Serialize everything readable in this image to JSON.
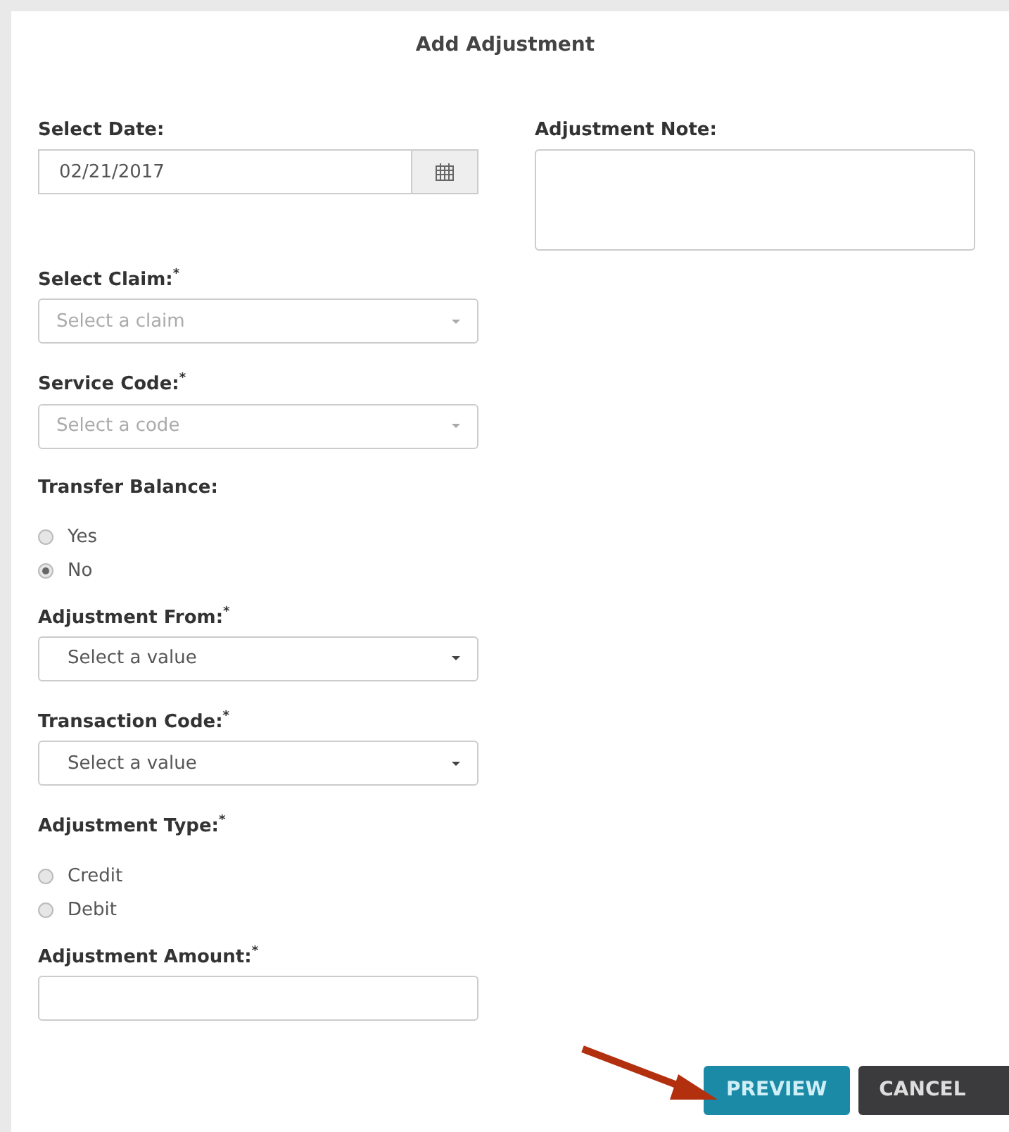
{
  "dialog": {
    "title": "Add Adjustment"
  },
  "date_field": {
    "label": "Select Date:",
    "value": "02/21/2017"
  },
  "note_field": {
    "label": "Adjustment Note:"
  },
  "fields": [
    {
      "kind": "combo",
      "label": "Select Claim:$^{*}$",
      "placeholder": "Select a claim"
    },
    {
      "kind": "combo",
      "label": "Service Code:$^{*}$",
      "placeholder": "Select a code"
    },
    {
      "kind": "radio",
      "label": "Transfer Balance:",
      "options": [
        {
          "label": "Yes",
          "selected": false
        },
        {
          "label": "No",
          "selected": true
        }
      ]
    },
    {
      "kind": "select",
      "label": "Adjustment From:$^{*}$",
      "placeholder": "Select a value"
    },
    {
      "kind": "select",
      "label": "Transaction Code:$^{*}$",
      "placeholder": "Select a value"
    },
    {
      "kind": "radio",
      "label": "Adjustment Type:$^{*}$",
      "options": [
        {
          "label": "Credit",
          "selected": false
        },
        {
          "label": "Debit",
          "selected": false
        }
      ]
    },
    {
      "kind": "text",
      "label": "Adjustment Amount:$^{*}$"
    }
  ],
  "buttons": [
    {
      "label": "PREVIEW",
      "kind": "primary"
    },
    {
      "label": "CANCEL",
      "kind": "dark"
    }
  ]
}
